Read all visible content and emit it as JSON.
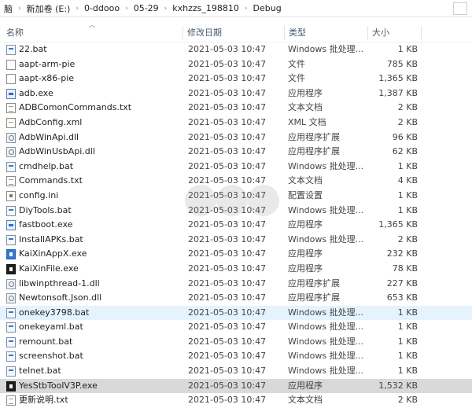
{
  "breadcrumb": [
    "脑",
    "新加卷 (E:)",
    "0-ddooo",
    "05-29",
    "kxhzzs_198810",
    "Debug"
  ],
  "columns": {
    "name": "名称",
    "date": "修改日期",
    "type": "类型",
    "size": "大小"
  },
  "rows": [
    {
      "name": "22.bat",
      "date": "2021-05-03 10:47",
      "type": "Windows 批处理...",
      "size": "1 KB",
      "icon": "bat"
    },
    {
      "name": "aapt-arm-pie",
      "date": "2021-05-03 10:47",
      "type": "文件",
      "size": "785 KB",
      "icon": "doc"
    },
    {
      "name": "aapt-x86-pie",
      "date": "2021-05-03 10:47",
      "type": "文件",
      "size": "1,365 KB",
      "icon": "doc"
    },
    {
      "name": "adb.exe",
      "date": "2021-05-03 10:47",
      "type": "应用程序",
      "size": "1,387 KB",
      "icon": "exe"
    },
    {
      "name": "ADBComonCommands.txt",
      "date": "2021-05-03 10:47",
      "type": "文本文档",
      "size": "2 KB",
      "icon": "txt"
    },
    {
      "name": "AdbConfig.xml",
      "date": "2021-05-03 10:47",
      "type": "XML 文档",
      "size": "2 KB",
      "icon": "xml"
    },
    {
      "name": "AdbWinApi.dll",
      "date": "2021-05-03 10:47",
      "type": "应用程序扩展",
      "size": "96 KB",
      "icon": "dll"
    },
    {
      "name": "AdbWinUsbApi.dll",
      "date": "2021-05-03 10:47",
      "type": "应用程序扩展",
      "size": "62 KB",
      "icon": "dll"
    },
    {
      "name": "cmdhelp.bat",
      "date": "2021-05-03 10:47",
      "type": "Windows 批处理...",
      "size": "1 KB",
      "icon": "bat"
    },
    {
      "name": "Commands.txt",
      "date": "2021-05-03 10:47",
      "type": "文本文档",
      "size": "4 KB",
      "icon": "txt"
    },
    {
      "name": "config.ini",
      "date": "2021-05-03 10:47",
      "type": "配置设置",
      "size": "1 KB",
      "icon": "cfg"
    },
    {
      "name": "DiyTools.bat",
      "date": "2021-05-03 10:47",
      "type": "Windows 批处理...",
      "size": "1 KB",
      "icon": "bat"
    },
    {
      "name": "fastboot.exe",
      "date": "2021-05-03 10:47",
      "type": "应用程序",
      "size": "1,365 KB",
      "icon": "exe"
    },
    {
      "name": "InstallAPKs.bat",
      "date": "2021-05-03 10:47",
      "type": "Windows 批处理...",
      "size": "2 KB",
      "icon": "bat"
    },
    {
      "name": "KaiXinAppX.exe",
      "date": "2021-05-03 10:47",
      "type": "应用程序",
      "size": "232 KB",
      "icon": "app"
    },
    {
      "name": "KaiXinFile.exe",
      "date": "2021-05-03 10:47",
      "type": "应用程序",
      "size": "78 KB",
      "icon": "dark"
    },
    {
      "name": "libwinpthread-1.dll",
      "date": "2021-05-03 10:47",
      "type": "应用程序扩展",
      "size": "227 KB",
      "icon": "dll"
    },
    {
      "name": "Newtonsoft.Json.dll",
      "date": "2021-05-03 10:47",
      "type": "应用程序扩展",
      "size": "653 KB",
      "icon": "dll"
    },
    {
      "name": "onekey3798.bat",
      "date": "2021-05-03 10:47",
      "type": "Windows 批处理...",
      "size": "1 KB",
      "icon": "bat"
    },
    {
      "name": "onekeyaml.bat",
      "date": "2021-05-03 10:47",
      "type": "Windows 批处理...",
      "size": "1 KB",
      "icon": "bat"
    },
    {
      "name": "remount.bat",
      "date": "2021-05-03 10:47",
      "type": "Windows 批处理...",
      "size": "1 KB",
      "icon": "bat"
    },
    {
      "name": "screenshot.bat",
      "date": "2021-05-03 10:47",
      "type": "Windows 批处理...",
      "size": "1 KB",
      "icon": "bat"
    },
    {
      "name": "telnet.bat",
      "date": "2021-05-03 10:47",
      "type": "Windows 批处理...",
      "size": "1 KB",
      "icon": "bat"
    },
    {
      "name": "YesStbToolV3P.exe",
      "date": "2021-05-03 10:47",
      "type": "应用程序",
      "size": "1,532 KB",
      "icon": "dark"
    },
    {
      "name": "更新说明.txt",
      "date": "2021-05-03 10:47",
      "type": "文本文档",
      "size": "2 KB",
      "icon": "txt"
    }
  ],
  "hover_row": 18,
  "selected_row": 23,
  "colors": {
    "hover": "#e5f3ff",
    "selected": "#d9d9d9",
    "header_text": "#4a5b6e"
  }
}
